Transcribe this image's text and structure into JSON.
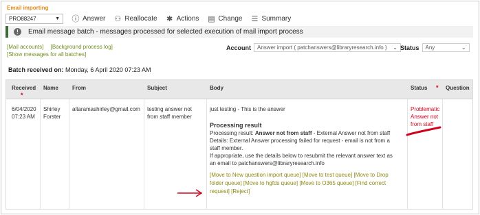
{
  "section_label": "Email importing",
  "toolbar": {
    "dropdown_value": "PRO88247",
    "answer_label": "Answer",
    "reallocate_label": "Reallocate",
    "actions_label": "Actions",
    "change_label": "Change",
    "summary_label": "Summary"
  },
  "info_bar": {
    "text": "Email message batch - messages processed for selected execution of mail import process"
  },
  "links": {
    "mail_accounts": "[Mail accounts]",
    "background_log": "[Background process log]",
    "show_all": "[Show messages for all batches]"
  },
  "filters": {
    "account_label": "Account",
    "account_value": "Answer import ( patchanswers@libraryresearch.info )",
    "status_label": "Status",
    "status_value": "Any"
  },
  "batch": {
    "label": "Batch received on:",
    "value": "Monday, 6 April 2020  07:23 AM"
  },
  "table": {
    "headers": {
      "received": "Received",
      "name": "Name",
      "from": "From",
      "subject": "Subject",
      "body": "Body",
      "status": "Status",
      "question": "Question"
    },
    "row": {
      "received_date": "6/04/2020",
      "received_time": "07:23 AM",
      "name_first": "Shirley",
      "name_last": "Forster",
      "from": "altaramashirley@gmail.com",
      "subject_1": "testing answer not",
      "subject_2": "from staff member",
      "body_intro": "just testing - This is the answer",
      "processing_title": "Processing result",
      "proc_line1_prefix": "Processing result: ",
      "proc_line1_bold": "Answer not from staff",
      "proc_line1_suffix": " - External Answer not from staff",
      "proc_line2": "Details: External Answer processing failed for request - email is not from a",
      "proc_line3": "staff member.",
      "proc_line4": "If appropriate, use the details below to resubmit the relevant answer text as",
      "proc_line5": "an email to patchanswers@libraryresearch.info",
      "queue_line1": "[Move to New question import queue]  [Move to test queue]  [Move to Drop",
      "queue_line2": "folder queue]  [Move to hgfds queue]  [Move to O365 queue]  [Find correct",
      "queue_line3": "request]  [Reject]",
      "status_1": "Problematic",
      "status_2": "Answer not",
      "status_3": "from staff"
    }
  },
  "colors": {
    "accent_orange": "#e08a1e",
    "link_green": "#6f8f1e",
    "error_red": "#d0021b",
    "info_border": "#3f6b3a"
  }
}
